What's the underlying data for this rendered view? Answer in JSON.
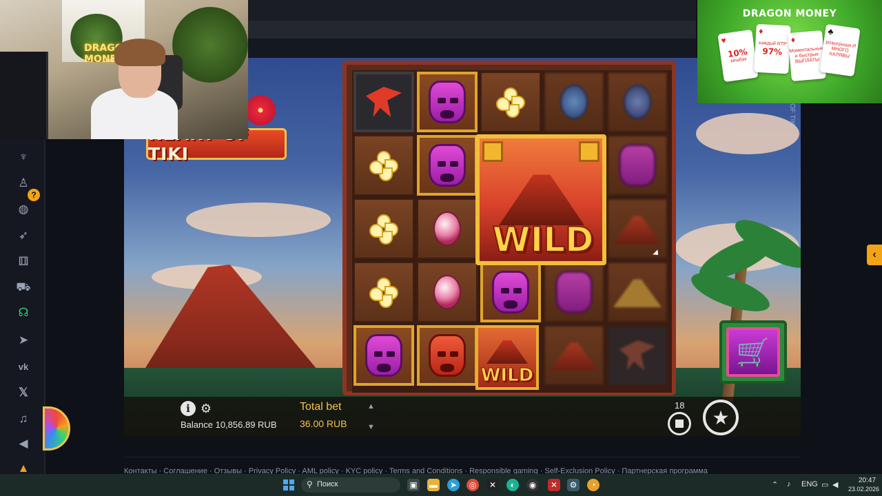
{
  "webcam": {
    "neon_text_1": "DRAGO",
    "neon_text_2": "MONE"
  },
  "game": {
    "logo": "HEART OF TIKI",
    "side_text": "OF TIKI",
    "wild_label": "WILD",
    "wild_label_small": "WILD",
    "buy_icon": "shopping-cart-icon"
  },
  "bottom_bar": {
    "info_icon": "i",
    "balance": "Balance 10,856.89 RUB",
    "total_bet_label": "Total bet",
    "total_bet_value": "36.00 RUB",
    "autospin_count": "18"
  },
  "ad": {
    "brand": "DRAGON MONEY",
    "cards": [
      {
        "value": "10%",
        "sub": "кешбэк"
      },
      {
        "value": "97%",
        "sub": "каждый RTP"
      },
      {
        "value": "",
        "sub": "Моментальные и быстрые ВЫПЛАТЫ"
      },
      {
        "value": "",
        "sub": "розыгрыши И МНОГО ХАЛЯВЫ"
      }
    ]
  },
  "sidebar": {
    "badge": "?",
    "icons": [
      "dragon-icon",
      "user-icon",
      "globe-icon",
      "rocket-icon",
      "dice-icon",
      "slot-machine-icon",
      "headset-icon",
      "telegram-icon",
      "vk-icon",
      "x-icon",
      "bell-icon",
      "volume-icon",
      "fire-icon"
    ]
  },
  "footer": {
    "links": "Контакты  ·  Соглашение  ·  Отзывы  ·  Privacy Policy  ·  AML policy  ·  KYC policy  ·  Terms and Conditions  ·  Responsible gaming  ·  Self-Exclusion Policy  ·  Партнерская программа"
  },
  "taskbar": {
    "search_placeholder": "Поиск",
    "lang": "ENG",
    "time": "20:47",
    "date": "23.02.2026"
  }
}
